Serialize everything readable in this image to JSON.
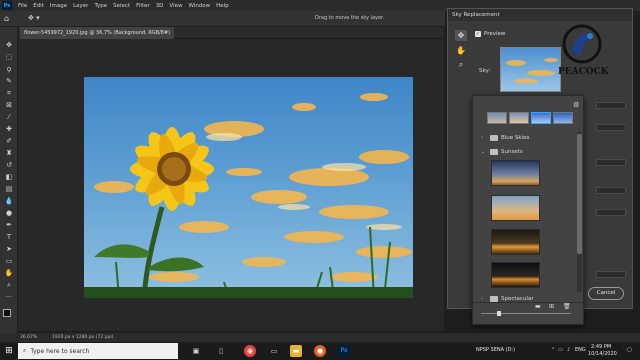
{
  "menubar": {
    "logo": "Ps",
    "items": [
      "File",
      "Edit",
      "Image",
      "Layer",
      "Type",
      "Select",
      "Filter",
      "3D",
      "View",
      "Window",
      "Help"
    ]
  },
  "options": {
    "hint": "Drag to move the sky layer."
  },
  "document": {
    "tab_title": "flower-5459972_1920.jpg @ 36.7% (Background, RGB/8#)"
  },
  "status": {
    "zoom": "36.67%",
    "info": "1920 px x 1280 px (72 ppi)"
  },
  "dialog": {
    "title": "Sky Replacement",
    "preview_label": "Preview",
    "sky_label": "Sky:",
    "cancel_label": "Cancel"
  },
  "watermark": {
    "text": "PEACOCK"
  },
  "sky_popup": {
    "folders": [
      {
        "label": "Blue Skies",
        "expanded": false
      },
      {
        "label": "Sunsets",
        "expanded": true
      },
      {
        "label": "Spectacular",
        "expanded": false
      }
    ]
  },
  "taskbar": {
    "search_placeholder": "Type here to search",
    "time": "2:49 PM",
    "date": "10/14/2020",
    "language": "ENG",
    "drive": "NPSP SENA (D:)"
  },
  "colors": {
    "accent_blue": "#31a8ff",
    "panel": "#3a3a3a",
    "app_bg": "#1e1e1e"
  }
}
